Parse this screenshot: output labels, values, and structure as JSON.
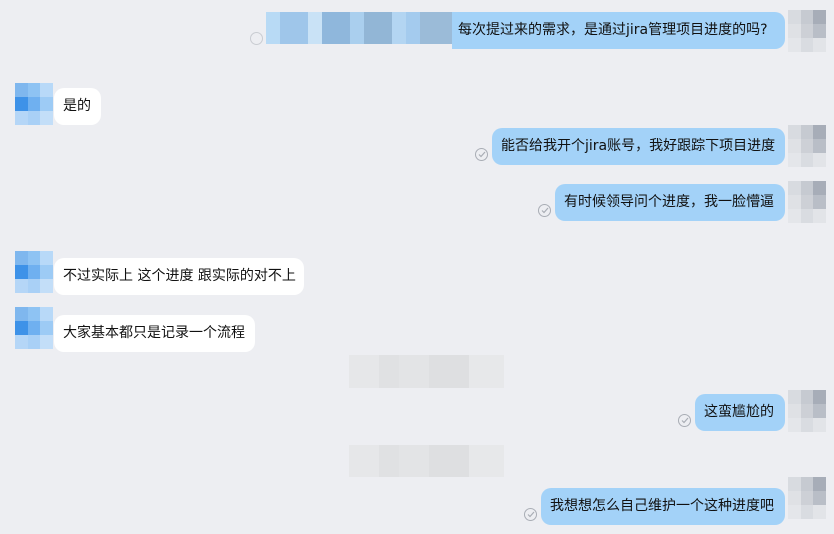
{
  "messages": [
    {
      "id": "m1",
      "side": "out",
      "text": "每次提过来的需求，是通过jira管理项目进度的吗?"
    },
    {
      "id": "m2",
      "side": "in",
      "text": "是的"
    },
    {
      "id": "m3",
      "side": "out",
      "text": "能否给我开个jira账号，我好跟踪下项目进度"
    },
    {
      "id": "m4",
      "side": "out",
      "text": "有时候领导问个进度，我一脸懵逼"
    },
    {
      "id": "m5",
      "side": "in",
      "text": "不过实际上 这个进度 跟实际的对不上"
    },
    {
      "id": "m6",
      "side": "in",
      "text": "大家基本都只是记录一个流程"
    },
    {
      "id": "m7",
      "side": "out",
      "text": "这蛮尴尬的"
    },
    {
      "id": "m8",
      "side": "out",
      "text": "我想想怎么自己维护一个这种进度吧"
    }
  ],
  "icons": {
    "read_receipt": "check-circle-icon",
    "sender_avatar": "pixelated-avatar",
    "self_avatar": "pixelated-avatar"
  },
  "colors": {
    "background": "#edeef2",
    "outgoing_bubble": "#a3d2f8",
    "incoming_bubble": "#ffffff",
    "read_icon": "#a9adb5"
  }
}
